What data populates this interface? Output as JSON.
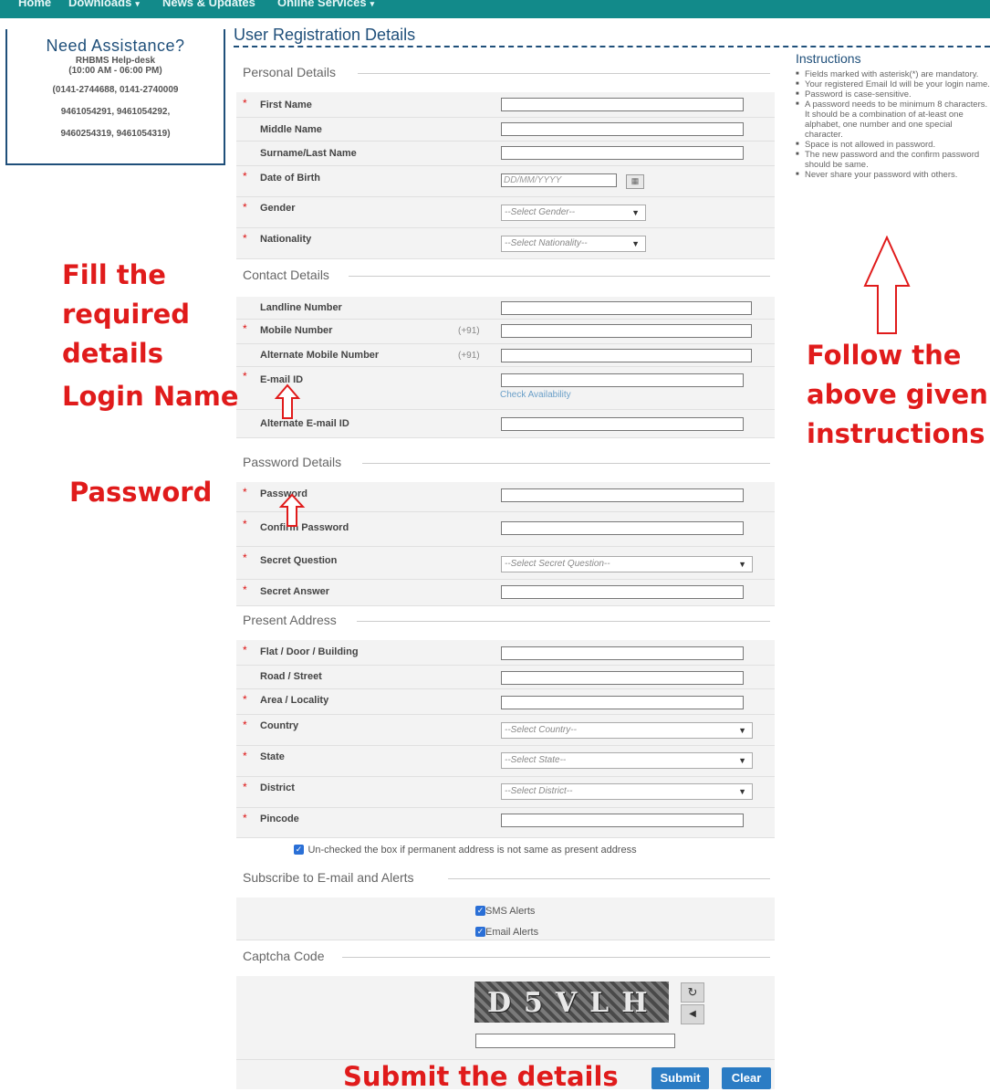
{
  "nav": {
    "items": [
      "Home",
      "Downloads",
      "News & Updates",
      "Online Services"
    ]
  },
  "assist": {
    "title": "Need Assistance?",
    "desk": "RHBMS Help-desk",
    "hours": "(10:00 AM - 06:00 PM)",
    "phones": [
      "(0141-2744688, 0141-2740009",
      "9461054291, 9461054292,",
      "9460254319, 9461054319)"
    ]
  },
  "page_title": "User Registration Details",
  "sections": {
    "personal": "Personal Details",
    "contact": "Contact Details",
    "password": "Password Details",
    "address": "Present Address",
    "subscribe": "Subscribe to E-mail and Alerts",
    "captcha": "Captcha Code"
  },
  "fields": {
    "first_name": "First Name",
    "middle_name": "Middle Name",
    "surname": "Surname/Last Name",
    "dob": "Date of Birth",
    "dob_placeholder": "DD/MM/YYYY",
    "gender": "Gender",
    "gender_select": "--Select Gender--",
    "nationality": "Nationality",
    "nationality_select": "--Select Nationality--",
    "landline": "Landline Number",
    "mobile": "Mobile Number",
    "alt_mobile": "Alternate Mobile Number",
    "mobile_prefix": "(+91)",
    "email": "E-mail ID",
    "check_availability": "Check Availability",
    "alt_email": "Alternate E-mail ID",
    "password": "Password",
    "confirm_password": "Confirm Password",
    "secret_question": "Secret Question",
    "secret_question_select": "--Select Secret Question--",
    "secret_answer": "Secret Answer",
    "flat": "Flat / Door / Building",
    "road": "Road / Street",
    "area": "Area / Locality",
    "country": "Country",
    "country_select": "--Select Country--",
    "state": "State",
    "state_select": "--Select State--",
    "district": "District",
    "district_select": "--Select District--",
    "pincode": "Pincode",
    "permanent_checkbox": "Un-checked the box if permanent address is not same as present address",
    "sms_alerts": "SMS Alerts",
    "email_alerts": "Email Alerts"
  },
  "captcha_text": "D5VLH",
  "buttons": {
    "submit": "Submit",
    "clear": "Clear"
  },
  "instructions": {
    "title": "Instructions",
    "items": [
      "Fields marked with asterisk(*) are mandatory.",
      "Your registered Email Id will be your login name.",
      "Password is case-sensitive.",
      "A password needs to be minimum 8 characters. It should be a combination of at-least one alphabet, one number and one special character.",
      "Space is not allowed in password.",
      "The new password and the confirm password should be same.",
      "Never share your password with others."
    ]
  },
  "annotations": {
    "fill": [
      "Fill the",
      "required",
      "details"
    ],
    "login_name": "Login Name",
    "password": "Password",
    "follow": [
      "Follow the",
      "above given",
      "instructions"
    ],
    "submit": "Submit the details"
  },
  "colors": {
    "nav": "#128a8a",
    "heading": "#1f4f7a",
    "annotation": "#e01b1b",
    "button": "#2b7cc4"
  }
}
